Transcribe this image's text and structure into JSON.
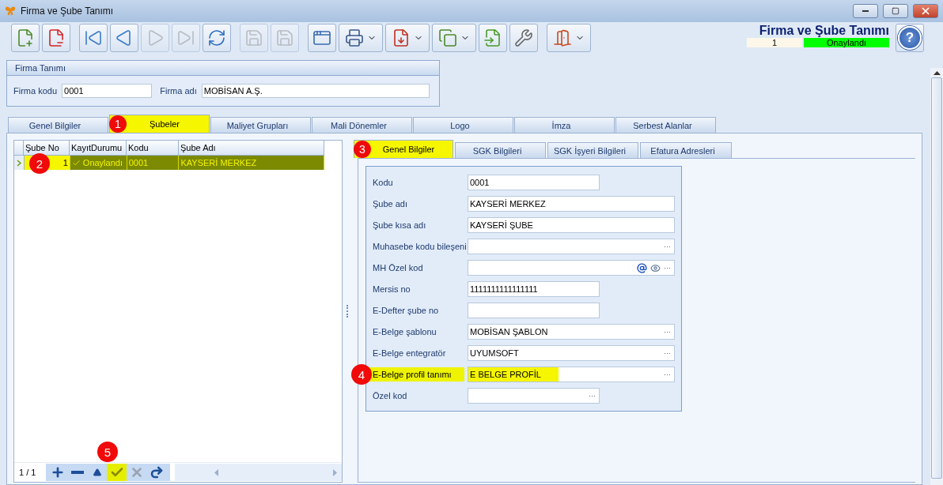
{
  "window": {
    "title": "Firma ve Şube Tanımı"
  },
  "toolbar": [
    {
      "disabled": false,
      "dropdown": false
    },
    {
      "disabled": false,
      "dropdown": false
    },
    {
      "disabled": false,
      "dropdown": false
    },
    {
      "disabled": false,
      "dropdown": false
    },
    {
      "disabled": true,
      "dropdown": false
    },
    {
      "disabled": true,
      "dropdown": false
    },
    {
      "disabled": false,
      "dropdown": false
    },
    {
      "disabled": true,
      "dropdown": false
    },
    {
      "disabled": true,
      "dropdown": false
    },
    {
      "disabled": false,
      "dropdown": false
    },
    {
      "disabled": false,
      "dropdown": true
    },
    {
      "disabled": false,
      "dropdown": true
    },
    {
      "disabled": false,
      "dropdown": true
    },
    {
      "disabled": false,
      "dropdown": false
    },
    {
      "disabled": false,
      "dropdown": false
    },
    {
      "disabled": false,
      "dropdown": true
    }
  ],
  "header": {
    "title": "Firma ve Şube Tanımı",
    "record": "1",
    "status": "Onaylandı"
  },
  "help_button": {
    "label": "?"
  },
  "firma_panel": {
    "title": "Firma Tanımı",
    "fields": [
      {
        "label": "Firma kodu",
        "value": "0001"
      },
      {
        "label": "Firma adı",
        "value": "MOBİSAN A.Ş."
      }
    ]
  },
  "tabs": [
    {
      "label": "Genel Bilgiler",
      "selected": false,
      "highlighted": false
    },
    {
      "label": "Şubeler",
      "selected": true,
      "highlighted": true,
      "callout": "1"
    },
    {
      "label": "Maliyet Grupları",
      "selected": false,
      "highlighted": false
    },
    {
      "label": "Mali Dönemler",
      "selected": false,
      "highlighted": false
    },
    {
      "label": "Logo",
      "selected": false,
      "highlighted": false
    },
    {
      "label": "İmza",
      "selected": false,
      "highlighted": false
    },
    {
      "label": "Serbest Alanlar",
      "selected": false,
      "highlighted": false
    }
  ],
  "grid": {
    "columns": [
      "Şube No",
      "KayıtDurumu",
      "Kodu",
      "Şube Adı"
    ],
    "rows": [
      {
        "selected": true,
        "callout": "2",
        "cells": [
          {
            "text": "1",
            "highlighted": true
          },
          {
            "text": "Onaylandı",
            "highlighted": false,
            "check": true
          },
          {
            "text": "0001",
            "highlighted": false
          },
          {
            "text": "KAYSERİ MERKEZ",
            "highlighted": false
          }
        ]
      }
    ],
    "navigator": {
      "position": "1 / 1",
      "buttons": [
        {
          "kind": "add",
          "disabled": false,
          "highlighted": false
        },
        {
          "kind": "remove",
          "disabled": false,
          "highlighted": false
        },
        {
          "kind": "up",
          "disabled": false,
          "highlighted": false
        },
        {
          "kind": "check",
          "disabled": false,
          "highlighted": true,
          "callout": "5"
        },
        {
          "kind": "cancel",
          "disabled": true,
          "highlighted": false
        },
        {
          "kind": "redo",
          "disabled": false,
          "highlighted": false
        }
      ]
    }
  },
  "sub_tabs": [
    {
      "label": "Genel Bilgiler",
      "selected": true,
      "highlighted": true,
      "callout": "3"
    },
    {
      "label": "SGK Bilgileri",
      "selected": false,
      "highlighted": false
    },
    {
      "label": "SGK İşyeri Bilgileri",
      "selected": false,
      "highlighted": false
    },
    {
      "label": "Efatura Adresleri",
      "selected": false,
      "highlighted": false
    }
  ],
  "form": [
    {
      "label": "Kodu",
      "value": "0001",
      "kind": "text",
      "highlighted": false
    },
    {
      "label": "Şube adı",
      "value": "KAYSERİ MERKEZ",
      "kind": "text",
      "highlighted": false
    },
    {
      "label": "Şube kısa adı",
      "value": "KAYSERİ ŞUBE",
      "kind": "text",
      "highlighted": false
    },
    {
      "label": "Muhasebe kodu bileşeni",
      "kind": "lookup",
      "button": "···",
      "highlighted": false
    },
    {
      "label": "MH Özel kod",
      "kind": "lookup_icons",
      "button": "···",
      "highlighted": false
    },
    {
      "label": "Mersis no",
      "value": "1111111111111111",
      "kind": "text",
      "highlighted": false
    },
    {
      "label": "E-Defter şube no",
      "kind": "text",
      "highlighted": false
    },
    {
      "label": "E-Belge şablonu",
      "value": "MOBİSAN ŞABLON",
      "kind": "lookup",
      "button": "···",
      "highlighted": false
    },
    {
      "label": "E-Belge entegratör",
      "value": "UYUMSOFT",
      "kind": "lookup",
      "button": "···",
      "highlighted": false
    },
    {
      "label": "E-Belge profil tanımı",
      "value": "E BELGE PROFİL",
      "kind": "lookup",
      "button": "···",
      "highlighted": true,
      "callout": "4"
    },
    {
      "label": "Özel kod",
      "kind": "lookup",
      "button": "···",
      "highlighted": false
    }
  ]
}
